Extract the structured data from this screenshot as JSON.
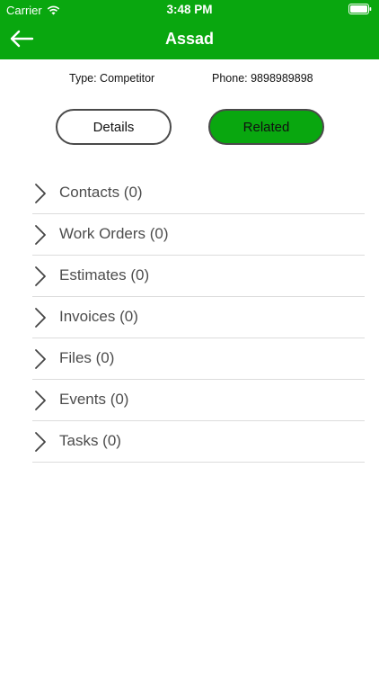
{
  "status": {
    "carrier": "Carrier",
    "time": "3:48 PM",
    "wifi_icon": "wifi-icon",
    "battery_icon": "battery-icon"
  },
  "nav": {
    "title": "Assad",
    "back_icon": "arrow-left-icon"
  },
  "info": {
    "type": "Type: Competitor",
    "phone": "Phone: 9898989898"
  },
  "segments": {
    "details": "Details",
    "related": "Related",
    "selected": "Related"
  },
  "colors": {
    "brand": "#09a70f",
    "text_muted": "#4d4d4d",
    "divider": "#dcdcdc"
  },
  "related": {
    "items": [
      {
        "label": "Contacts (0)"
      },
      {
        "label": "Work Orders (0)"
      },
      {
        "label": "Estimates (0)"
      },
      {
        "label": "Invoices (0)"
      },
      {
        "label": "Files (0)"
      },
      {
        "label": "Events (0)"
      },
      {
        "label": "Tasks (0)"
      }
    ]
  }
}
